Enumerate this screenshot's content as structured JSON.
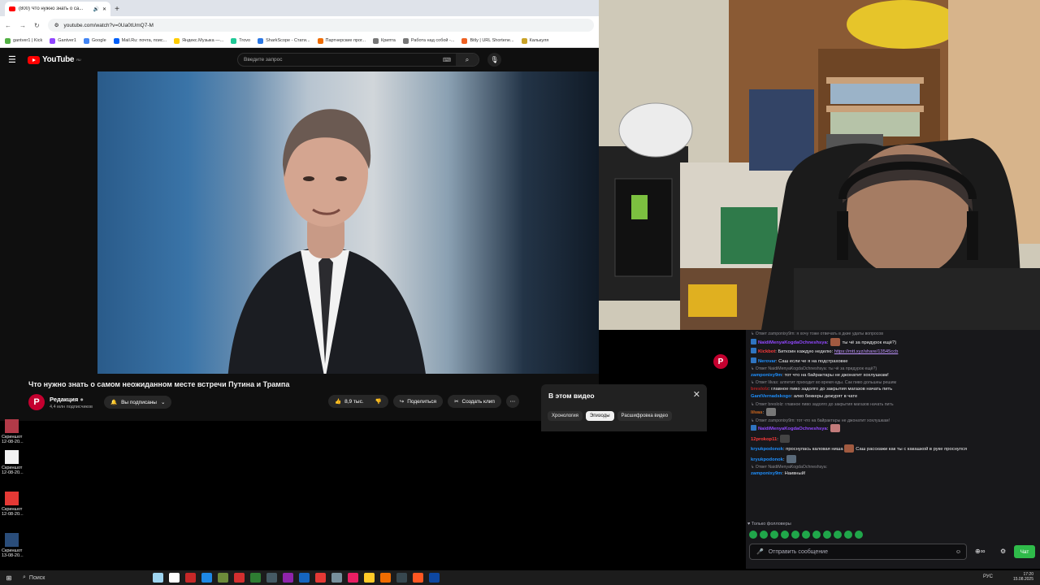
{
  "browser": {
    "tab_title": "(800) Что нужно знать о са...",
    "url": "youtube.com/watch?v=0Ua0tUmQ7-M",
    "bookmarks": [
      "gantver1 | Kick",
      "Gantver1",
      "Google",
      "Mail.Ru: почта, поис...",
      "Яндекс.Музыка —...",
      "Trovo",
      "SharkScope - Стати...",
      "Партнерские прог...",
      "Крипта",
      "Работа над собой -...",
      "Bitly | URL Shortene...",
      "Калькуля"
    ],
    "bookmark_colors": [
      "#52b043",
      "#9146ff",
      "#4285f4",
      "#005ff9",
      "#ffcc00",
      "#20c997",
      "#2b78e4",
      "#ef6c00",
      "#777777",
      "#777777",
      "#ee6123",
      "#c9a227"
    ]
  },
  "youtube": {
    "logo_text": "YouTube",
    "region": "RU",
    "search_placeholder": "Введите запрос",
    "video_title": "Что нужно знать о самом неожиданном месте встречи Путина и Трампа",
    "channel_name": "Редакция",
    "channel_initial": "P",
    "subscribers": "4,4 млн подписчиков",
    "subscribed_label": "Вы подписаны",
    "likes": "8,9 тыс.",
    "share_label": "Поделиться",
    "clip_label": "Создать клип",
    "panel_title": "В этом видео",
    "panel_chips": [
      "Хронология",
      "Эпизоды",
      "Расшифровка видео"
    ],
    "active_chip": "Эпизоды"
  },
  "desktop_icons": [
    {
      "label": "Скриншот",
      "sub": "12-08-20...",
      "color": "#b23a48"
    },
    {
      "label": "Скриншот",
      "sub": "12-08-20...",
      "color": "#f2f2f2"
    },
    {
      "label": "Скриншот",
      "sub": "12-08-20...",
      "color": "#e53935"
    },
    {
      "label": "Скриншот",
      "sub": "13-08-20...",
      "color": "#2a4d7a"
    }
  ],
  "chat": {
    "lines": [
      {
        "type": "reply",
        "text": "Ответ zamponixy9m: я хочу тоже отвечать в дкие удаты вопросов"
      },
      {
        "type": "msg",
        "user": "NaidiMenyaKogdaOchneshsya",
        "cls": "u1",
        "badge": "#2f74c0",
        "text": ": ",
        "emote": "#a15a40",
        "after": " ты чё за придурок ещё?)"
      },
      {
        "type": "msg",
        "user": "Kickbot",
        "cls": "u2",
        "badge": "#2f74c0",
        "text": ": Биткоин каждую неделю: ",
        "link": "https://mtt.xyz/share/13545ccb"
      },
      {
        "type": "msg",
        "user": "Nerovar",
        "cls": "u3",
        "badge": "#2f74c0",
        "text": ": Саш если че я на подстраховке"
      },
      {
        "type": "reply",
        "text": "Ответ NaidiMenyaKogdaOchneshsya: ты чё за придурок ещё?)"
      },
      {
        "type": "msg",
        "user": "zamponixy9m",
        "cls": "u3",
        "text": ": тот что на байрактары не джонатит хохлушкам!"
      },
      {
        "type": "reply",
        "text": "Ответ lilvas: алпетит приходит во время еды. Сак пиво дольшеы решим"
      },
      {
        "type": "msg",
        "user": "breslolz",
        "cls": "u6",
        "text": ": главное пиво задолго до закрытия магазов начать пить"
      },
      {
        "type": "msg",
        "user": "GantVernadskogo",
        "cls": "u3",
        "text": ": алко беккеры дежурят в чате"
      },
      {
        "type": "reply",
        "text": "Ответ breslolz: главное пиво задолго до закрытия магазов начать пить"
      },
      {
        "type": "msg",
        "user": "lilvas",
        "cls": "u5",
        "text": ": ",
        "emote": "#777777"
      },
      {
        "type": "reply",
        "text": "Ответ zamponixy9m: тот что на байрактары не джонатит хохлушкам!"
      },
      {
        "type": "msg",
        "user": "NaidiMenyaKogdaOchneshsya",
        "cls": "u1",
        "badge": "#2f74c0",
        "text": ": ",
        "emote": "#c27b7b"
      },
      {
        "type": "msg",
        "user": "12prokop11",
        "cls": "u2",
        "text": ": ",
        "emote": "#444444"
      },
      {
        "type": "msg",
        "user": "kryukpodonok",
        "cls": "u3",
        "text": ": проснулась каловая ниша",
        "emote": "#a15a40",
        "after": " Саш расскажи как ты с какашкой в руке проснулся"
      },
      {
        "type": "msg",
        "user": "kryukpodonok",
        "cls": "u3",
        "text": ": ",
        "emote": "#5a6a7a"
      },
      {
        "type": "reply",
        "text": "Ответ NaidiMenyaKogdaOchneshsya: "
      },
      {
        "type": "msg",
        "user": "zamponixy9m",
        "cls": "u3",
        "text": ": Наивный!"
      }
    ],
    "followers_only": "Только фолловеры",
    "input_placeholder": "Отправить сообщение",
    "send_label": "Чат"
  },
  "taskbar": {
    "search_label": "Поиск",
    "lang": "РУС",
    "time": "17:20",
    "date": "15.08.2025",
    "app_colors": [
      "#9fd5f0",
      "#ffffff",
      "#c62828",
      "#1e88e5",
      "#6d8b3a",
      "#d32f2f",
      "#2e7d32",
      "#455a64",
      "#8e24aa",
      "#1565c0",
      "#e53935",
      "#78909c",
      "#e91e63",
      "#ffca28",
      "#ef6c00",
      "#37474f",
      "#ff5722",
      "#0d47a1"
    ]
  }
}
